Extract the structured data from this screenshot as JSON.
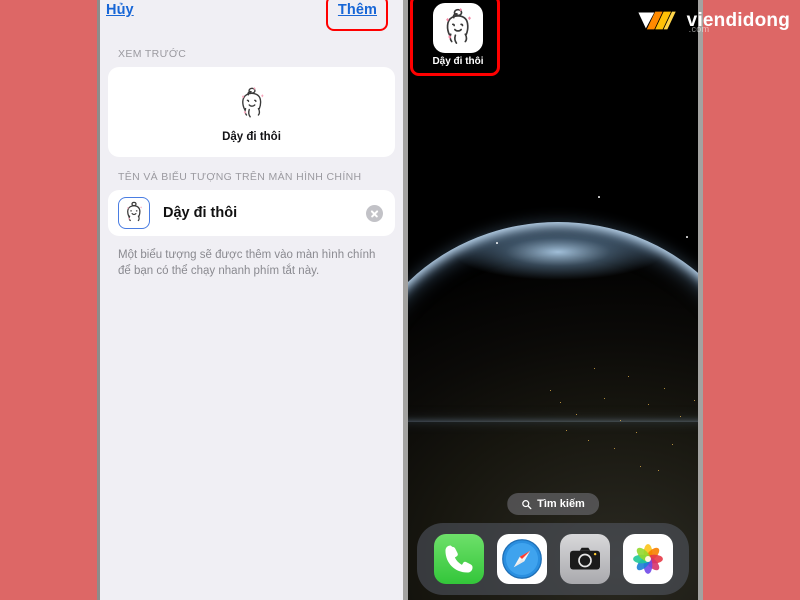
{
  "background_color": "#dd6766",
  "sheet": {
    "cancel_label": "Hủy",
    "add_label": "Thêm",
    "preview_section_header": "XEM TRƯỚC",
    "preview_shortcut_name": "Dậy đi thôi",
    "name_section_header": "TÊN VÀ BIỂU TƯỢNG TRÊN MÀN HÌNH CHÍNH",
    "name_field_value": "Dậy đi thôi",
    "clear_button_label": "×",
    "footnote": "Một biểu tượng sẽ được thêm vào màn hình chính để bạn có thể chạy nhanh phím tắt này.",
    "highlight_color": "#ff0000",
    "link_color": "#1766d6"
  },
  "phone": {
    "home_app_label": "Dậy đi thôi",
    "search_label": "Tìm kiếm",
    "search_icon": "search-icon",
    "dock": [
      {
        "name": "Phone",
        "icon": "phone-icon"
      },
      {
        "name": "Safari",
        "icon": "compass-icon"
      },
      {
        "name": "Camera",
        "icon": "camera-icon"
      },
      {
        "name": "Photos",
        "icon": "photos-flower-icon"
      }
    ]
  },
  "watermark": {
    "brand": "viendidong",
    "suffix": ".com",
    "mark_icon": "viendidong-logo-icon",
    "mark_colors": [
      "#ffffff",
      "#ff8a00",
      "#ffc107"
    ]
  }
}
